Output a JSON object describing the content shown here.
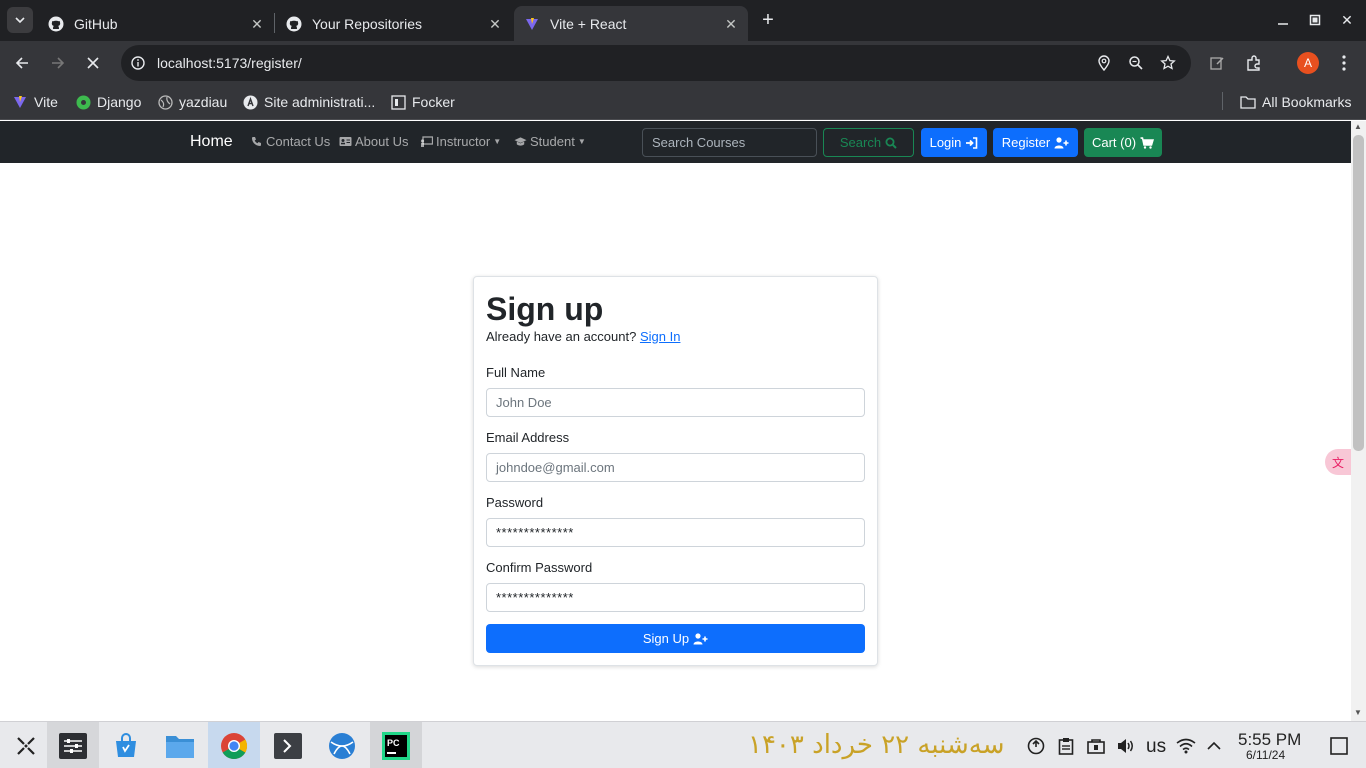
{
  "browser": {
    "tabs": [
      {
        "title": "GitHub",
        "icon": "github-icon"
      },
      {
        "title": "Your Repositories",
        "icon": "github-icon"
      },
      {
        "title": "Vite + React",
        "icon": "vite-icon",
        "active": true
      }
    ],
    "url": "localhost:5173/register/",
    "profile_initial": "A",
    "bookmarks": [
      {
        "label": "Vite",
        "icon": "vite-icon"
      },
      {
        "label": "Django",
        "icon": "django-icon"
      },
      {
        "label": "yazdiau",
        "icon": "globe-icon"
      },
      {
        "label": "Site administrati...",
        "icon": "admin-icon"
      },
      {
        "label": "Focker",
        "icon": "focker-icon"
      }
    ],
    "all_bookmarks": "All Bookmarks"
  },
  "site_nav": {
    "brand": "Home",
    "links": {
      "contact": "Contact Us",
      "about": "About Us",
      "instructor": "Instructor",
      "student": "Student"
    },
    "search_placeholder": "Search Courses",
    "search_btn": "Search",
    "login_btn": "Login",
    "register_btn": "Register",
    "cart_btn": "Cart (0)"
  },
  "form": {
    "title": "Sign up",
    "subtitle": "Already have an account?",
    "signin_link": "Sign In",
    "full_name_label": "Full Name",
    "full_name_placeholder": "John Doe",
    "email_label": "Email Address",
    "email_placeholder": "johndoe@gmail.com",
    "password_label": "Password",
    "password_value": "**************",
    "confirm_label": "Confirm Password",
    "confirm_value": "**************",
    "submit": "Sign Up"
  },
  "taskbar": {
    "persian_date": "سه‌شنبه ۲۲ خرداد ۱۴۰۳",
    "keyboard_layout": "us",
    "time": "5:55 PM",
    "date": "6/11/24"
  }
}
